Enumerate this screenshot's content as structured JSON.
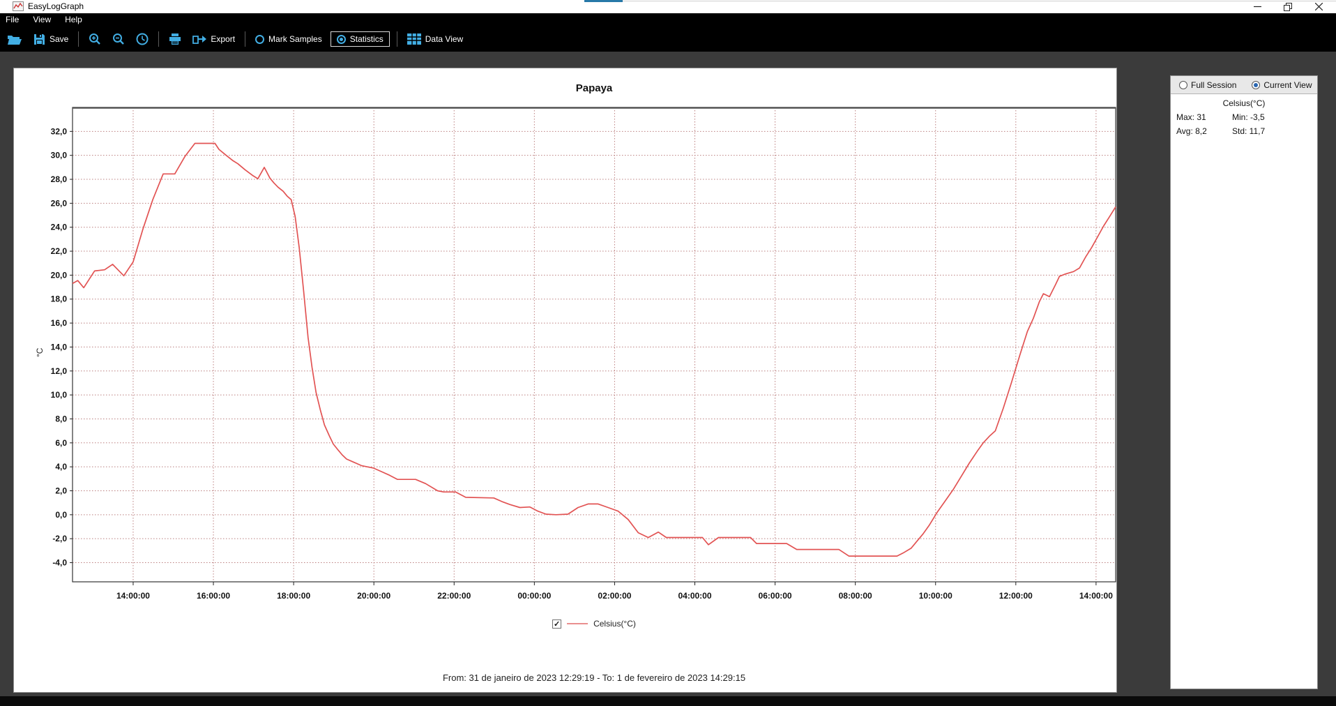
{
  "window": {
    "title": "EasyLogGraph"
  },
  "menu": {
    "items": [
      "File",
      "View",
      "Help"
    ]
  },
  "toolbar": {
    "save_label": "Save",
    "export_label": "Export",
    "mark_samples_label": "Mark Samples",
    "statistics_label": "Statistics",
    "data_view_label": "Data View"
  },
  "stats_panel": {
    "full_session_label": "Full Session",
    "current_view_label": "Current View",
    "channel_header": "Celsius(°C)",
    "max_text": "Max: 31",
    "min_text": "Min: -3,5",
    "avg_text": "Avg: 8,2",
    "std_text": "Std: 11,7"
  },
  "chart": {
    "title": "Papaya",
    "y_axis_unit": "°C",
    "legend_checkbox": "✓",
    "legend_label": "Celsius(°C)",
    "footer": "From: 31 de janeiro de 2023 12:29:19  -  To: 1 de fevereiro de 2023 14:29:15"
  },
  "colors": {
    "series_red": "#e25353",
    "legend_line_red": "#e98f8f",
    "grid_red": "#bb7f7f",
    "toolbar_blue": "#42aee4",
    "radio_blue": "#2a66b0",
    "axis_dark": "#333333"
  },
  "chart_data": {
    "type": "line",
    "title": "Papaya",
    "xlabel": "",
    "ylabel": "°C",
    "xlim": [
      0,
      26
    ],
    "ylim": [
      -5.6,
      34.0
    ],
    "grid": "dotted both axes",
    "legend_position": "bottom center",
    "x_unit": "hours since 31/01/2023 12:29:19",
    "x_ticks": [
      {
        "t": 1.5114,
        "label": "14:00:00"
      },
      {
        "t": 3.5114,
        "label": "16:00:00"
      },
      {
        "t": 5.5114,
        "label": "18:00:00"
      },
      {
        "t": 7.5114,
        "label": "20:00:00"
      },
      {
        "t": 9.5114,
        "label": "22:00:00"
      },
      {
        "t": 11.5114,
        "label": "00:00:00"
      },
      {
        "t": 13.5114,
        "label": "02:00:00"
      },
      {
        "t": 15.5114,
        "label": "04:00:00"
      },
      {
        "t": 17.5114,
        "label": "06:00:00"
      },
      {
        "t": 19.5114,
        "label": "08:00:00"
      },
      {
        "t": 21.5114,
        "label": "10:00:00"
      },
      {
        "t": 23.5114,
        "label": "12:00:00"
      },
      {
        "t": 25.5114,
        "label": "14:00:00"
      }
    ],
    "y_ticks": [
      {
        "v": 32,
        "label": "32,0"
      },
      {
        "v": 30,
        "label": "30,0"
      },
      {
        "v": 28,
        "label": "28,0"
      },
      {
        "v": 26,
        "label": "26,0"
      },
      {
        "v": 24,
        "label": "24,0"
      },
      {
        "v": 22,
        "label": "22,0"
      },
      {
        "v": 20,
        "label": "20,0"
      },
      {
        "v": 18,
        "label": "18,0"
      },
      {
        "v": 16,
        "label": "16,0"
      },
      {
        "v": 14,
        "label": "14,0"
      },
      {
        "v": 12,
        "label": "12,0"
      },
      {
        "v": 10,
        "label": "10,0"
      },
      {
        "v": 8,
        "label": "8,0"
      },
      {
        "v": 6,
        "label": "6,0"
      },
      {
        "v": 4,
        "label": "4,0"
      },
      {
        "v": 2,
        "label": "2,0"
      },
      {
        "v": 0,
        "label": "0,0"
      },
      {
        "v": -2,
        "label": "-2,0"
      },
      {
        "v": -4,
        "label": "-4,0"
      }
    ],
    "series": [
      {
        "name": "Celsius(°C)",
        "color": "#e25353",
        "points": [
          [
            0,
            19.3
          ],
          [
            0.13,
            19.55
          ],
          [
            0.28,
            18.95
          ],
          [
            0.55,
            20.35
          ],
          [
            0.8,
            20.45
          ],
          [
            1.0,
            20.9
          ],
          [
            1.28,
            19.95
          ],
          [
            1.51,
            21.1
          ],
          [
            1.75,
            23.8
          ],
          [
            2.0,
            26.3
          ],
          [
            2.26,
            28.45
          ],
          [
            2.55,
            28.45
          ],
          [
            2.8,
            29.9
          ],
          [
            3.05,
            31.0
          ],
          [
            3.55,
            31.0
          ],
          [
            3.65,
            30.5
          ],
          [
            3.83,
            30.0
          ],
          [
            4.0,
            29.55
          ],
          [
            4.12,
            29.3
          ],
          [
            4.3,
            28.8
          ],
          [
            4.5,
            28.3
          ],
          [
            4.62,
            28.05
          ],
          [
            4.78,
            29.0
          ],
          [
            4.92,
            28.1
          ],
          [
            5.02,
            27.7
          ],
          [
            5.12,
            27.35
          ],
          [
            5.25,
            27.0
          ],
          [
            5.35,
            26.6
          ],
          [
            5.45,
            26.3
          ],
          [
            5.55,
            24.9
          ],
          [
            5.65,
            22.3
          ],
          [
            5.76,
            18.7
          ],
          [
            5.87,
            14.8
          ],
          [
            5.97,
            12.3
          ],
          [
            6.07,
            10.2
          ],
          [
            6.18,
            8.7
          ],
          [
            6.28,
            7.5
          ],
          [
            6.4,
            6.6
          ],
          [
            6.5,
            5.9
          ],
          [
            6.62,
            5.4
          ],
          [
            6.72,
            5.0
          ],
          [
            6.83,
            4.65
          ],
          [
            7.0,
            4.4
          ],
          [
            7.2,
            4.1
          ],
          [
            7.5,
            3.9
          ],
          [
            7.7,
            3.6
          ],
          [
            7.9,
            3.3
          ],
          [
            8.1,
            2.95
          ],
          [
            8.55,
            2.95
          ],
          [
            8.8,
            2.6
          ],
          [
            9.1,
            2.0
          ],
          [
            9.25,
            1.9
          ],
          [
            9.55,
            1.9
          ],
          [
            9.8,
            1.45
          ],
          [
            10.5,
            1.4
          ],
          [
            10.7,
            1.1
          ],
          [
            10.9,
            0.85
          ],
          [
            11.15,
            0.6
          ],
          [
            11.4,
            0.65
          ],
          [
            11.6,
            0.3
          ],
          [
            11.8,
            0.05
          ],
          [
            12.05,
            0.0
          ],
          [
            12.35,
            0.05
          ],
          [
            12.6,
            0.6
          ],
          [
            12.85,
            0.9
          ],
          [
            13.1,
            0.9
          ],
          [
            13.35,
            0.6
          ],
          [
            13.6,
            0.3
          ],
          [
            13.85,
            -0.4
          ],
          [
            14.1,
            -1.5
          ],
          [
            14.35,
            -1.9
          ],
          [
            14.6,
            -1.45
          ],
          [
            14.8,
            -1.9
          ],
          [
            15.7,
            -1.9
          ],
          [
            15.85,
            -2.5
          ],
          [
            16.1,
            -1.9
          ],
          [
            16.9,
            -1.9
          ],
          [
            17.05,
            -2.4
          ],
          [
            17.8,
            -2.4
          ],
          [
            18.05,
            -2.9
          ],
          [
            19.1,
            -2.9
          ],
          [
            19.35,
            -3.45
          ],
          [
            20.55,
            -3.45
          ],
          [
            20.7,
            -3.2
          ],
          [
            20.9,
            -2.8
          ],
          [
            21.05,
            -2.2
          ],
          [
            21.2,
            -1.6
          ],
          [
            21.35,
            -0.9
          ],
          [
            21.55,
            0.2
          ],
          [
            21.75,
            1.15
          ],
          [
            21.95,
            2.1
          ],
          [
            22.15,
            3.2
          ],
          [
            22.35,
            4.3
          ],
          [
            22.55,
            5.3
          ],
          [
            22.7,
            6.0
          ],
          [
            22.85,
            6.55
          ],
          [
            23.0,
            7.0
          ],
          [
            23.2,
            8.9
          ],
          [
            23.4,
            11.0
          ],
          [
            23.6,
            13.2
          ],
          [
            23.8,
            15.3
          ],
          [
            23.95,
            16.4
          ],
          [
            24.1,
            17.8
          ],
          [
            24.2,
            18.45
          ],
          [
            24.35,
            18.2
          ],
          [
            24.5,
            19.2
          ],
          [
            24.6,
            19.9
          ],
          [
            24.75,
            20.1
          ],
          [
            24.95,
            20.3
          ],
          [
            25.1,
            20.6
          ],
          [
            25.25,
            21.5
          ],
          [
            25.4,
            22.3
          ],
          [
            25.55,
            23.2
          ],
          [
            25.7,
            24.1
          ],
          [
            25.85,
            24.9
          ],
          [
            26.0,
            25.7
          ]
        ]
      }
    ],
    "stats_current_view": {
      "max": 31,
      "min": -3.5,
      "avg": 8.2,
      "std": 11.7
    }
  }
}
